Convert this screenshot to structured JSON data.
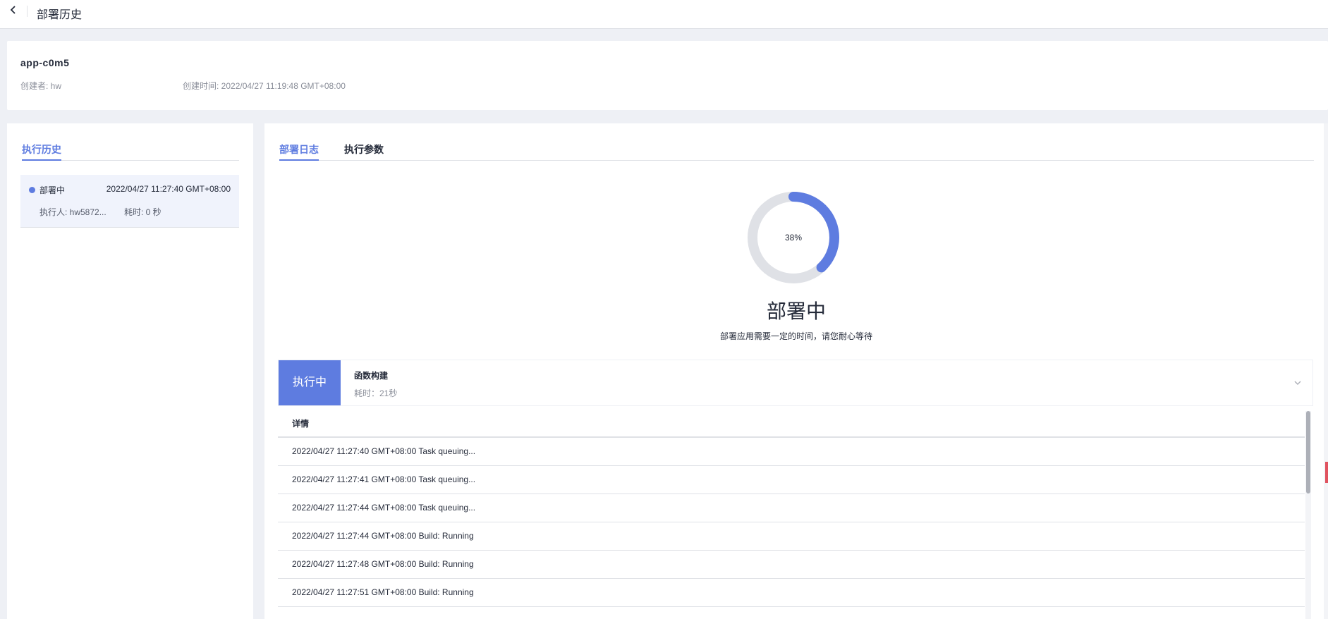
{
  "header": {
    "title": "部署历史",
    "back_icon": "chevron-left-icon"
  },
  "app_info": {
    "name": "app-c0m5",
    "creator": "创建者: hw",
    "created_time": "创建时间: 2022/04/27 11:19:48 GMT+08:00"
  },
  "history": {
    "tab_label": "执行历史",
    "items": [
      {
        "status": "部署中",
        "time": "2022/04/27 11:27:40 GMT+08:00",
        "executor": "执行人: hw5872...",
        "duration": "耗时: 0 秒"
      }
    ]
  },
  "detail": {
    "tabs": [
      {
        "label": "部署日志"
      },
      {
        "label": "执行参数"
      }
    ],
    "progress": {
      "percent": 38,
      "percent_label": "38%"
    },
    "status_title": "部署中",
    "status_hint": "部署应用需要一定的时间，请您耐心等待",
    "stage": {
      "badge": "执行中",
      "name": "函数构建",
      "duration": "耗时：21秒"
    },
    "log": {
      "header": "详情",
      "rows": [
        "2022/04/27 11:27:40 GMT+08:00 Task queuing...",
        "2022/04/27 11:27:41 GMT+08:00 Task queuing...",
        "2022/04/27 11:27:44 GMT+08:00 Task queuing...",
        "2022/04/27 11:27:44 GMT+08:00 Build: Running",
        "2022/04/27 11:27:48 GMT+08:00 Build: Running",
        "2022/04/27 11:27:51 GMT+08:00 Build: Running"
      ]
    }
  },
  "colors": {
    "accent": "#5e7ce0",
    "track": "#dfe1e6",
    "background": "#eef0f5"
  }
}
